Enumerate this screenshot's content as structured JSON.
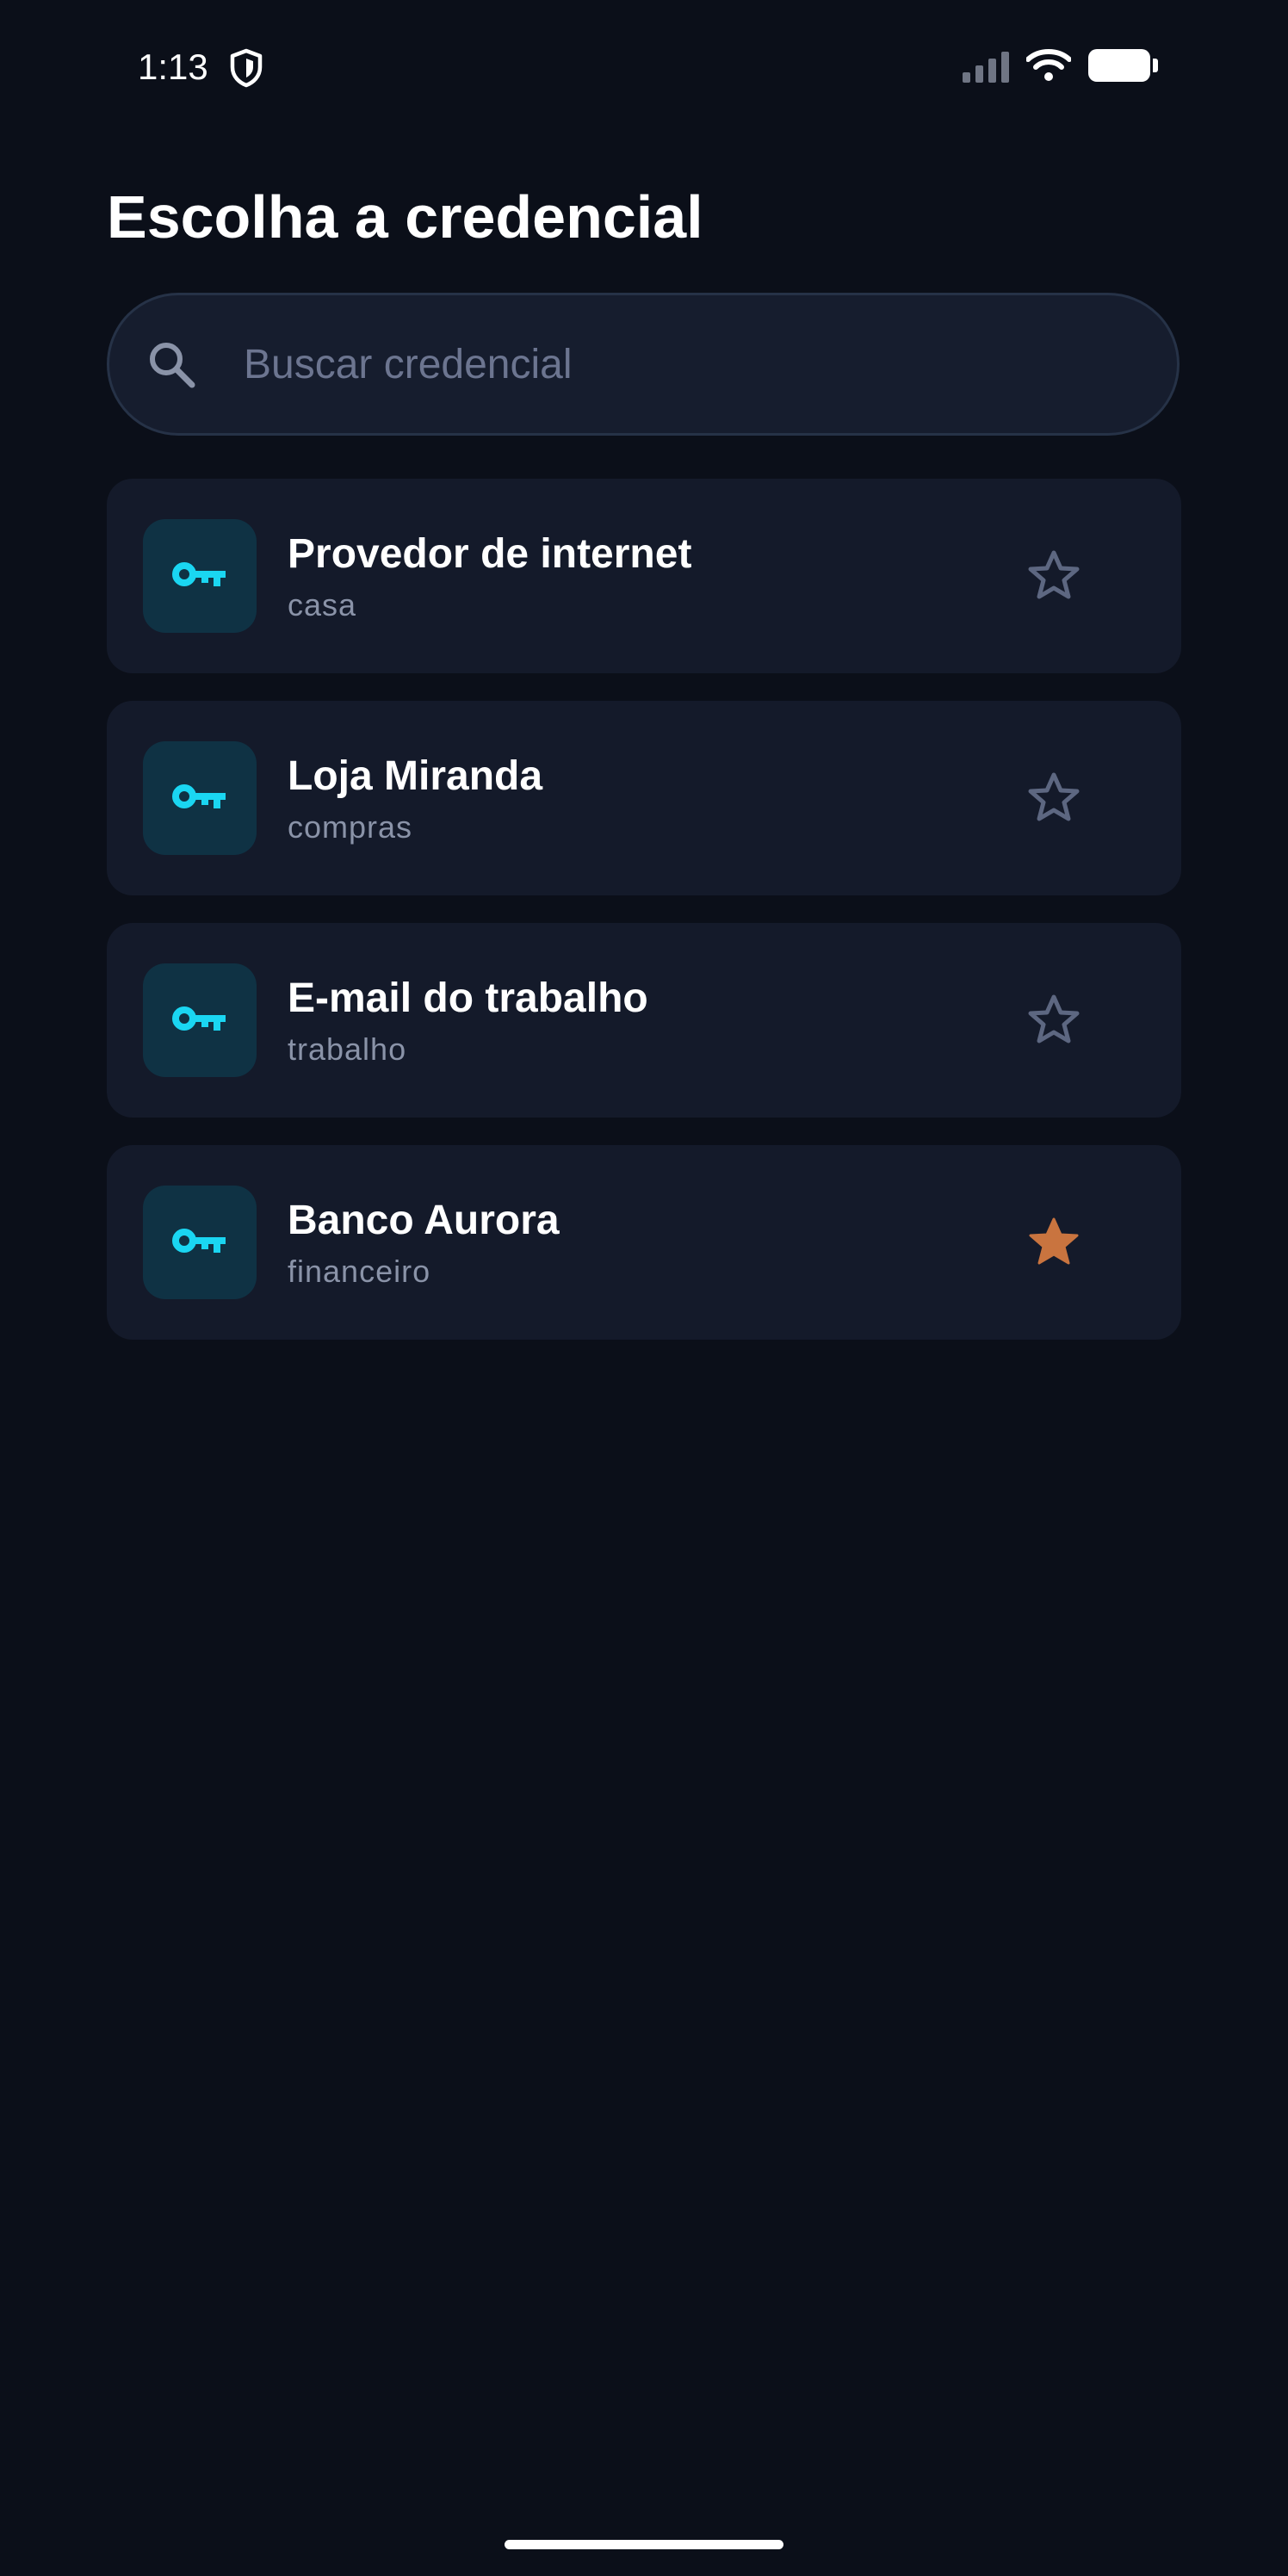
{
  "status_bar": {
    "time": "1:13",
    "shield_icon": "shield-icon",
    "signal_icon": "signal-icon",
    "wifi_icon": "wifi-icon",
    "battery_icon": "battery-icon"
  },
  "page": {
    "title": "Escolha a credencial"
  },
  "search": {
    "icon": "search-icon",
    "placeholder": "Buscar credencial",
    "value": ""
  },
  "credentials": [
    {
      "title": "Provedor de internet",
      "subtitle": "casa",
      "icon": "key-icon",
      "favorite": false
    },
    {
      "title": "Loja Miranda",
      "subtitle": "compras",
      "icon": "key-icon",
      "favorite": false
    },
    {
      "title": "E-mail do trabalho",
      "subtitle": "trabalho",
      "icon": "key-icon",
      "favorite": false
    },
    {
      "title": "Banco Aurora",
      "subtitle": "financeiro",
      "icon": "key-icon",
      "favorite": true
    }
  ],
  "colors": {
    "background": "#0b0f19",
    "card": "#141a2a",
    "accent": "#1ad6f2",
    "icon_box": "#0f3244",
    "star_outline": "#5d6781",
    "star_filled": "#c9743f",
    "subtitle": "#8a93a8"
  }
}
